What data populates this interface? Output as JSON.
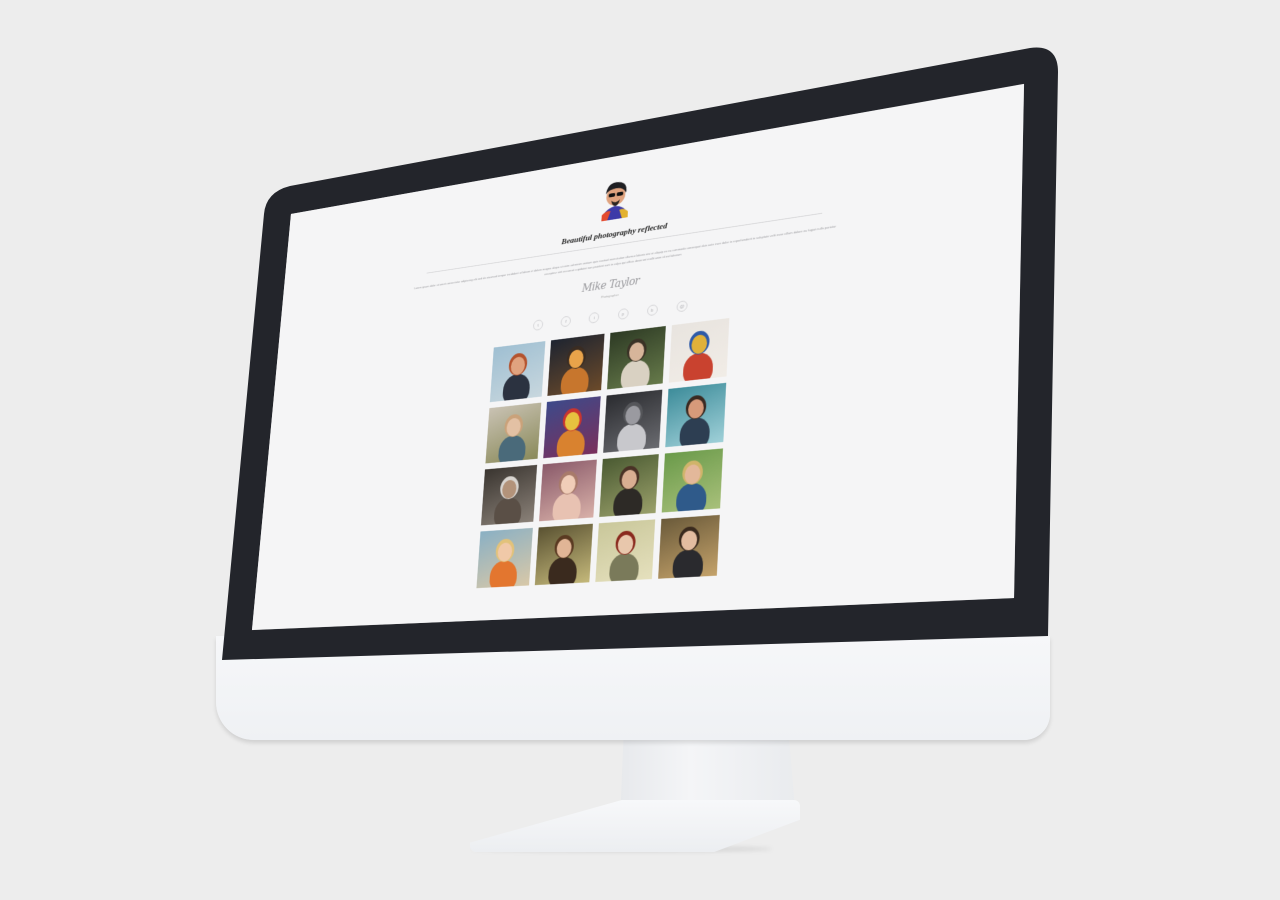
{
  "site": {
    "title": "Beautiful photography reflected",
    "intro": "Lorem ipsum dolor sit amet consectetur adipiscing elit sed do eiusmod tempor incididunt ut labore et dolore magna aliqua ut enim ad minim veniam quis nostrud exercitation ullamco laboris nisi ut aliquip ex ea commodo consequat duis aute irure dolor in reprehenderit in voluptate velit esse cillum dolore eu fugiat nulla pariatur excepteur sint occaecat cupidatat non proident sunt in culpa qui officia deserunt mollit anim id est laborum",
    "signature": "Mike Taylor",
    "signature_role": "Photographer",
    "social_icons": [
      "twitter-icon",
      "facebook-icon",
      "instagram-icon",
      "pinterest-icon",
      "behance-icon",
      "mail-icon"
    ],
    "social_glyphs": [
      "t",
      "f",
      "i",
      "p",
      "b",
      "@"
    ]
  },
  "gallery": [
    {
      "name": "portrait-red-hair",
      "bg": [
        "#9fbfd2",
        "#c8d7de"
      ],
      "fig": "#2b3240",
      "face": "#e0a37f",
      "hair": "#b4532e"
    },
    {
      "name": "sunset-landscape",
      "bg": [
        "#1e2430",
        "#6b4a2a"
      ],
      "fig": "#c7762d",
      "face": "#e9a34a",
      "hair": "#3a2c22"
    },
    {
      "name": "dancer-on-grass",
      "bg": [
        "#2d3a24",
        "#667a4a"
      ],
      "fig": "#d9d1c2",
      "face": "#d7b59a",
      "hair": "#3a3226"
    },
    {
      "name": "painted-man",
      "bg": [
        "#e8e4df",
        "#f1ece6"
      ],
      "fig": "#c9422f",
      "face": "#e0b13a",
      "hair": "#2e5aa8"
    },
    {
      "name": "girl-in-field",
      "bg": [
        "#c9c2b3",
        "#8a8a5a"
      ],
      "fig": "#4a6a7a",
      "face": "#e3c1a4",
      "hair": "#caa27a"
    },
    {
      "name": "colorful-face",
      "bg": [
        "#3d4a8a",
        "#7a2f5c"
      ],
      "fig": "#d9822f",
      "face": "#e7c23f",
      "hair": "#c9352f"
    },
    {
      "name": "bw-figure",
      "bg": [
        "#2a2b2f",
        "#6a6b70"
      ],
      "fig": "#c8c8cc",
      "face": "#9a9aa0",
      "hair": "#55565a"
    },
    {
      "name": "couple-in-water",
      "bg": [
        "#3d8c9a",
        "#9fd0d8"
      ],
      "fig": "#2d3e52",
      "face": "#d79a7a",
      "hair": "#3a2a22"
    },
    {
      "name": "old-man-smoking",
      "bg": [
        "#3a3530",
        "#8a8178"
      ],
      "fig": "#5a4f46",
      "face": "#b3937a",
      "hair": "#d8d4cf"
    },
    {
      "name": "sleeping-baby",
      "bg": [
        "#8a5a6a",
        "#d8b0a8"
      ],
      "fig": "#e8c2b2",
      "face": "#f0cdb8",
      "hair": "#a87a6a"
    },
    {
      "name": "woman-lying-grass",
      "bg": [
        "#4a5a32",
        "#9aa06a"
      ],
      "fig": "#2d2a26",
      "face": "#d9ae92",
      "hair": "#4a3226"
    },
    {
      "name": "child-in-meadow",
      "bg": [
        "#6a9a4a",
        "#a8c07a"
      ],
      "fig": "#2f5a8a",
      "face": "#e3b89a",
      "hair": "#d0b46a"
    },
    {
      "name": "smiling-toddler",
      "bg": [
        "#8ab0c4",
        "#d8c8a8"
      ],
      "fig": "#e3762f",
      "face": "#f0c9a8",
      "hair": "#e2c27a"
    },
    {
      "name": "woman-flowing-hair",
      "bg": [
        "#5a5232",
        "#c4b87a"
      ],
      "fig": "#3a2a1e",
      "face": "#e1b596",
      "hair": "#5a3a22"
    },
    {
      "name": "girl-vintage",
      "bg": [
        "#c9c79a",
        "#e5e0bd"
      ],
      "fig": "#7a7a5a",
      "face": "#e8c7ac",
      "hair": "#8a2a1e"
    },
    {
      "name": "wedding-couple",
      "bg": [
        "#6a5a3a",
        "#c4a26a"
      ],
      "fig": "#2a2a2e",
      "face": "#e3bca0",
      "hair": "#3a2a1e"
    }
  ]
}
